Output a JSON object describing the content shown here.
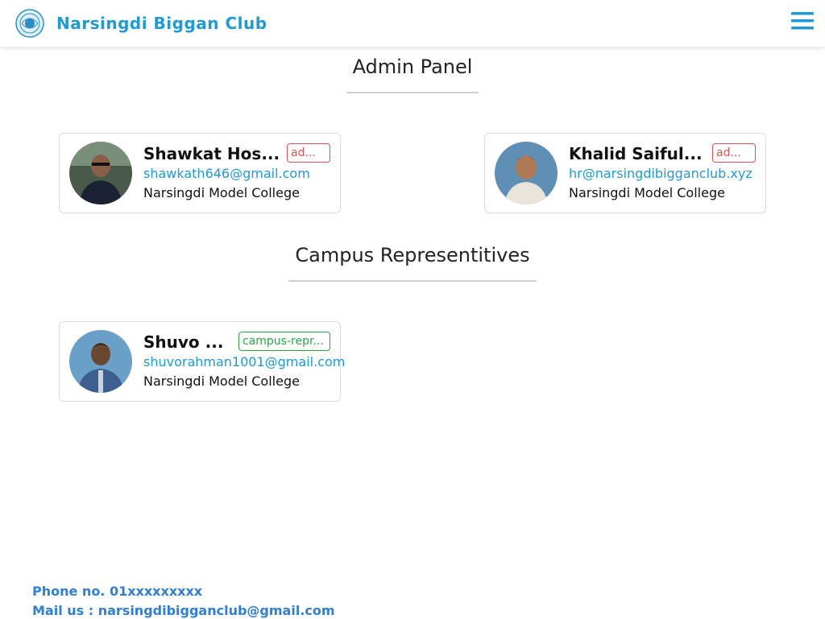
{
  "header": {
    "brand": "Narsingdi Biggan Club",
    "logo_icon": "club-logo-icon",
    "menu_icon": "hamburger-menu-icon",
    "accent_color": "#1e9ad6"
  },
  "admin_section": {
    "title": "Admin Panel",
    "members": [
      {
        "name": "Shawkat Hos...",
        "role": "ad...",
        "email": "shawkath646@gmail.com",
        "college": "Narsingdi Model College"
      },
      {
        "name": "Khalid Saiful...",
        "role": "ad...",
        "email": "hr@narsingdibigganclub.xyz",
        "college": "Narsingdi Model College"
      }
    ]
  },
  "campus_section": {
    "title": "Campus Representitives",
    "members": [
      {
        "name": "Shuvo ...",
        "role": "campus-repr...",
        "email": "shuvorahman1001@gmail.com",
        "college": "Narsingdi Model College"
      }
    ]
  },
  "footer": {
    "phone": "Phone no. 01xxxxxxxxx",
    "mail": "Mail us : narsingdibigganclub@gmail.com"
  }
}
